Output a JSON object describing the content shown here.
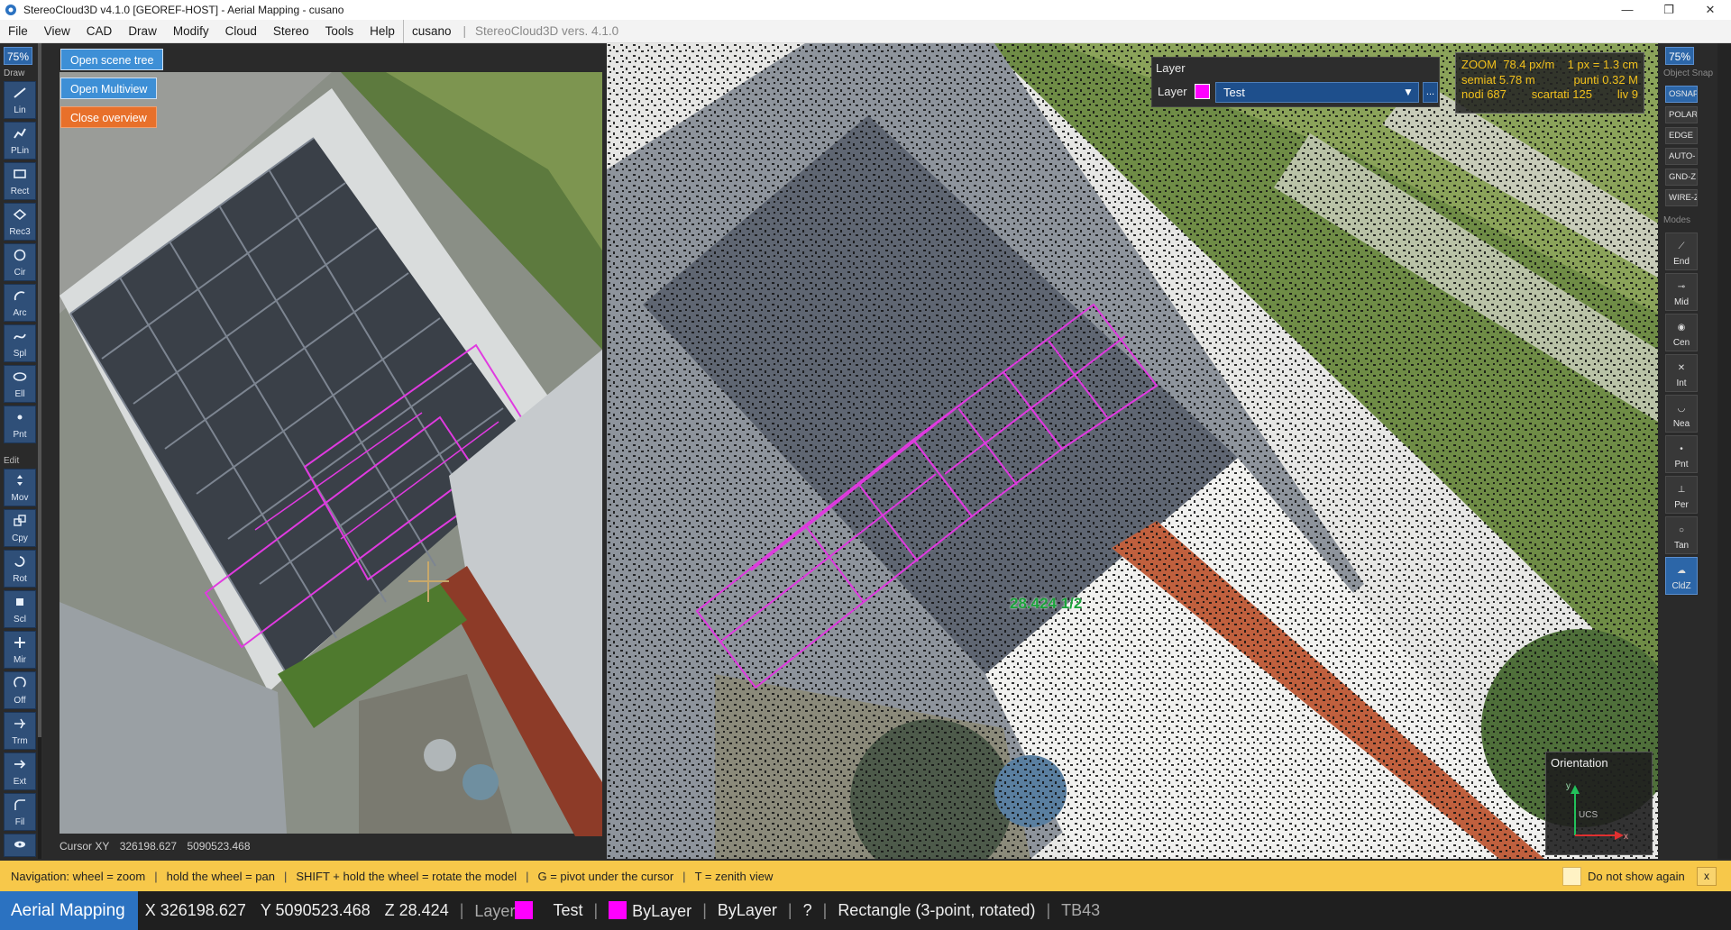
{
  "window": {
    "title": "StereoCloud3D v4.1.0  [GEOREF-HOST]  - Aerial Mapping  - cusano",
    "controls": [
      "—",
      "❐",
      "✕"
    ]
  },
  "menu": {
    "items": [
      "File",
      "View",
      "CAD",
      "Draw",
      "Modify",
      "Cloud",
      "Stereo",
      "Tools",
      "Help"
    ],
    "user": "cusano",
    "version": "StereoCloud3D vers. 4.1.0"
  },
  "left_toolbar": {
    "zoom": "75%",
    "draw_label": "Draw",
    "edit_label": "Edit",
    "draw_tools": [
      "Lin",
      "PLin",
      "Rect",
      "Rec3",
      "Cir",
      "Arc",
      "Spl",
      "Ell",
      "Pnt"
    ],
    "edit_tools": [
      "Mov",
      "Cpy",
      "Rot",
      "Scl",
      "Mir",
      "Off",
      "Trm",
      "Ext",
      "Fil"
    ]
  },
  "overview": {
    "open_scene_tree": "Open scene tree",
    "open_multiview": "Open Multiview",
    "close_overview": "Close overview",
    "cursor_label": "Cursor XY",
    "cursor_x": "326198.627",
    "cursor_y": "5090523.468"
  },
  "layer_panel": {
    "title": "Layer",
    "row_label": "Layer",
    "selected_layer": "Test",
    "layer_color": "#ff00ff",
    "arrow": "▼",
    "more": "..."
  },
  "zoom_info": {
    "zoom_label": "ZOOM",
    "zoom_value": "78.4 px/m",
    "px_value": "1 px = 1.3 cm",
    "semiaxis": "semiat  5.78 m",
    "points": "punti 0.32 M",
    "nodes": "nodi 687",
    "discarded": "scartati  125",
    "level": "liv 9"
  },
  "measure_label": "28.424  1/2",
  "orientation": {
    "title": "Orientation",
    "axis_y": "y",
    "axis_x": "x",
    "ucs": "UCS"
  },
  "right_panel": {
    "zoom": "75%",
    "object_snap_label": "Object Snap",
    "snaps": [
      "OSNAP",
      "POLAR",
      "EDGE",
      "AUTO-",
      "GND-Z",
      "WIRE-Z"
    ],
    "modes_label": "Modes",
    "modes": [
      "End",
      "Mid",
      "Cen",
      "Int",
      "Nea",
      "Pnt",
      "Per",
      "Tan",
      "CldZ"
    ]
  },
  "nav_tip": {
    "items": [
      "Navigation:  wheel = zoom",
      "hold the wheel = pan",
      "SHIFT + hold the wheel = rotate the model",
      "G = pivot under the cursor",
      "T = zenith view"
    ],
    "dont_show": "Do not show again",
    "close": "x"
  },
  "status": {
    "mode": "Aerial Mapping",
    "x": "X 326198.627",
    "y": "Y 5090523.468",
    "z": "Z 28.424",
    "layer_label": "Layer",
    "layer_name": "Test",
    "color": "ByLayer",
    "linetype": "ByLayer",
    "help": "?",
    "command": "Rectangle (3-point, rotated)",
    "tb": "TB43"
  },
  "colors": {
    "accent": "#2b72c1",
    "layer": "#ff00ff",
    "tip_bar": "#f7c84a",
    "zoom_text": "#f2c11c",
    "measure": "#1aa33a"
  }
}
